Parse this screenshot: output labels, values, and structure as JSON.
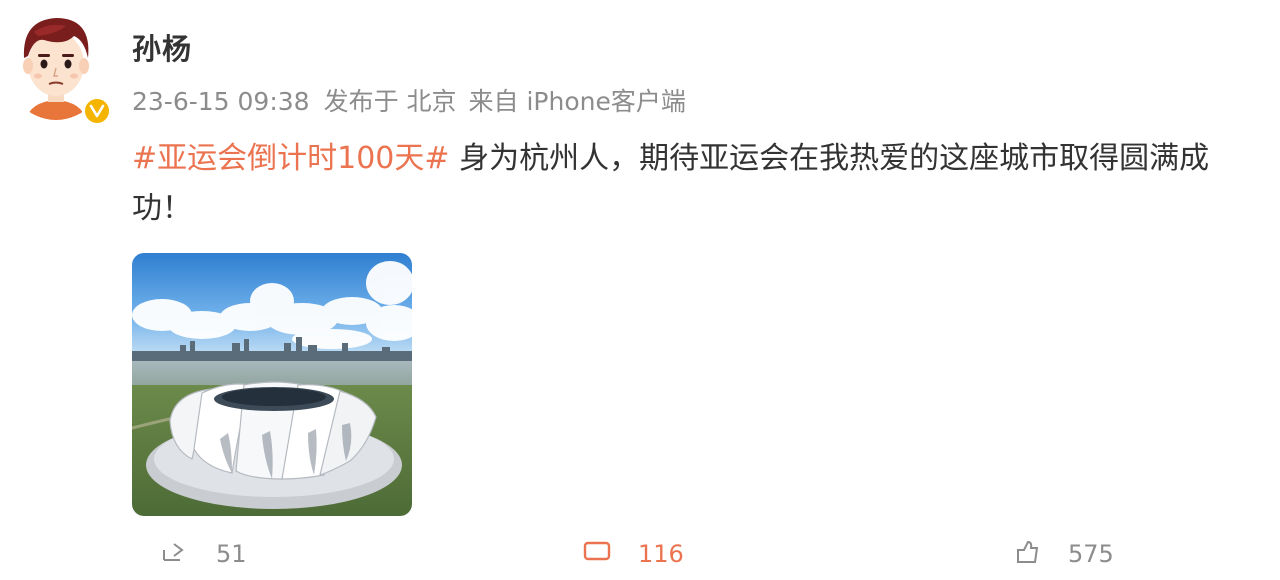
{
  "user": {
    "name": "孙杨",
    "avatar_icon": "cartoon-avatar-icon",
    "verified_icon": "verified-badge-icon",
    "verified_color": "#f4b400"
  },
  "meta": {
    "time": "23-6-15 09:38",
    "location": "发布于 北京",
    "source": "来自 iPhone客户端"
  },
  "post": {
    "hashtag": "#亚运会倒计时100天#",
    "text": " 身为杭州人，期待亚运会在我热爱的这座城市取得圆满成功！",
    "hashtag_color": "#eb7350",
    "image_icon": "stadium-photo"
  },
  "actions": {
    "share_count": "51",
    "comment_count": "116",
    "like_count": "575",
    "share_icon": "share-icon",
    "comment_icon": "comment-icon",
    "like_icon": "like-icon"
  }
}
